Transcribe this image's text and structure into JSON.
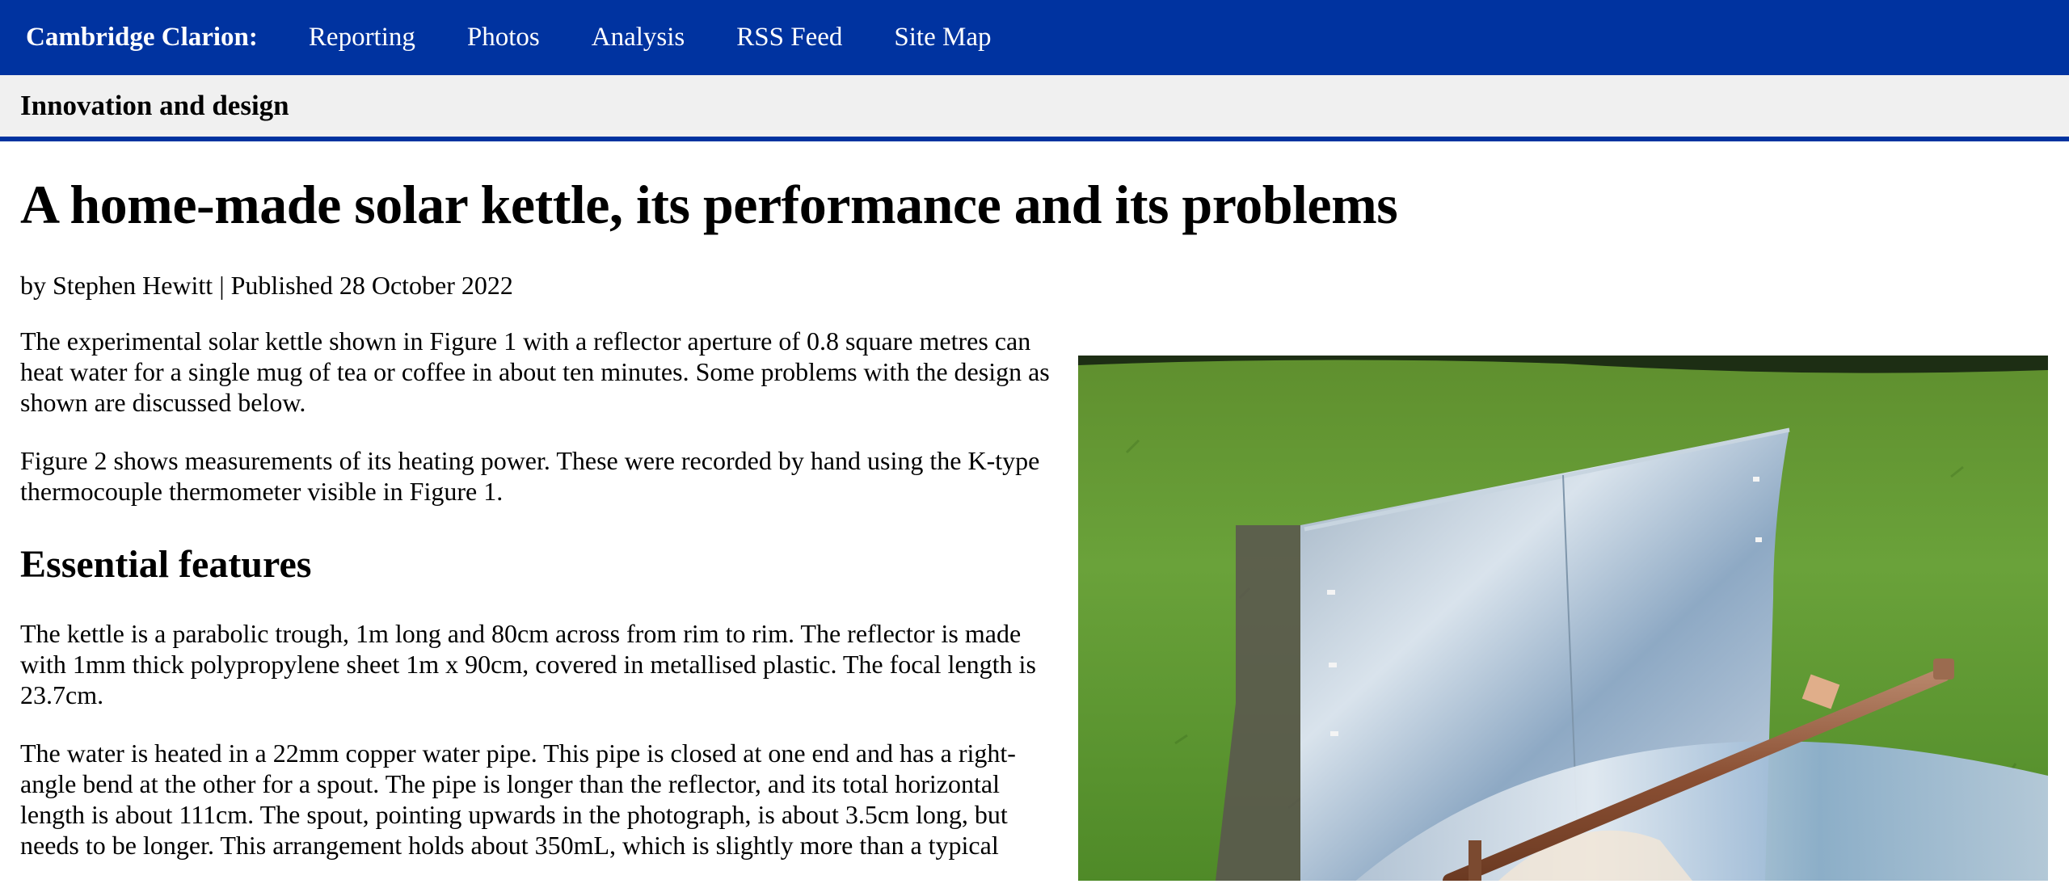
{
  "nav": {
    "brand": "Cambridge Clarion:",
    "links": [
      "Reporting",
      "Photos",
      "Analysis",
      "RSS Feed",
      "Site Map"
    ]
  },
  "section": {
    "title": "Innovation and design"
  },
  "article": {
    "title": "A home-made solar kettle, its performance and its problems",
    "byline": "by Stephen Hewitt | Published 28 October 2022",
    "paragraphs": [
      "The experimental solar kettle shown in Figure 1 with a reflector aperture of 0.8 square metres can heat water for a single mug of tea or coffee in about ten minutes. Some problems with the design as shown are discussed below.",
      "Figure 2 shows measurements of its heating power. These were recorded by hand using the K-type thermocouple thermometer visible in Figure 1."
    ],
    "heading_essential": "Essential features",
    "essential_paragraphs": [
      "The kettle is a parabolic trough, 1m long and 80cm across from rim to rim. The reflector is made with 1mm thick polypropylene sheet 1m x 90cm, covered in metallised plastic. The focal length is 23.7cm.",
      "The water is heated in a 22mm copper water pipe. This pipe is closed at one end and has a right-angle bend at the other for a spout. The pipe is longer than the reflector, and its total horizontal length is about 111cm. The spout, pointing upwards in the photograph, is about 3.5cm long, but needs to be longer. This arrangement holds about 350mL, which is slightly more than a typical"
    ]
  },
  "colors": {
    "nav_background": "#0033a0",
    "section_background": "#f0f0f0"
  }
}
